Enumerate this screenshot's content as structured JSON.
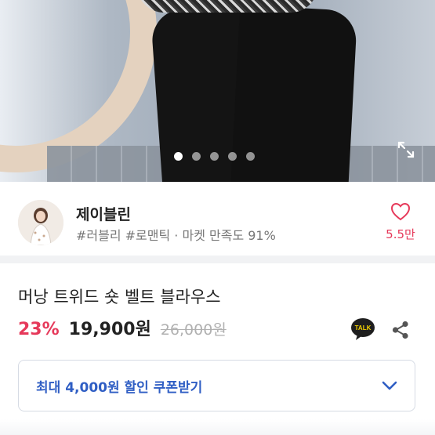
{
  "gallery": {
    "slide_count": 5,
    "active_index": 0
  },
  "shop": {
    "name": "제이블린",
    "tags": "#러블리 #로맨틱 · 마켓 만족도 91%",
    "likes": "5.5만"
  },
  "product": {
    "title": "머낭 트위드 숏 벨트 블라우스",
    "discount": "23%",
    "price": "19,900원",
    "original_price": "26,000원"
  },
  "actions": {
    "talk_badge": "TALK"
  },
  "coupon": {
    "label": "최대 4,000원 할인 쿠폰받기"
  },
  "colors": {
    "accent_pink": "#e6395a",
    "coupon_blue": "#2f5ec4",
    "text_dark": "#222222",
    "text_gray": "#777777"
  }
}
